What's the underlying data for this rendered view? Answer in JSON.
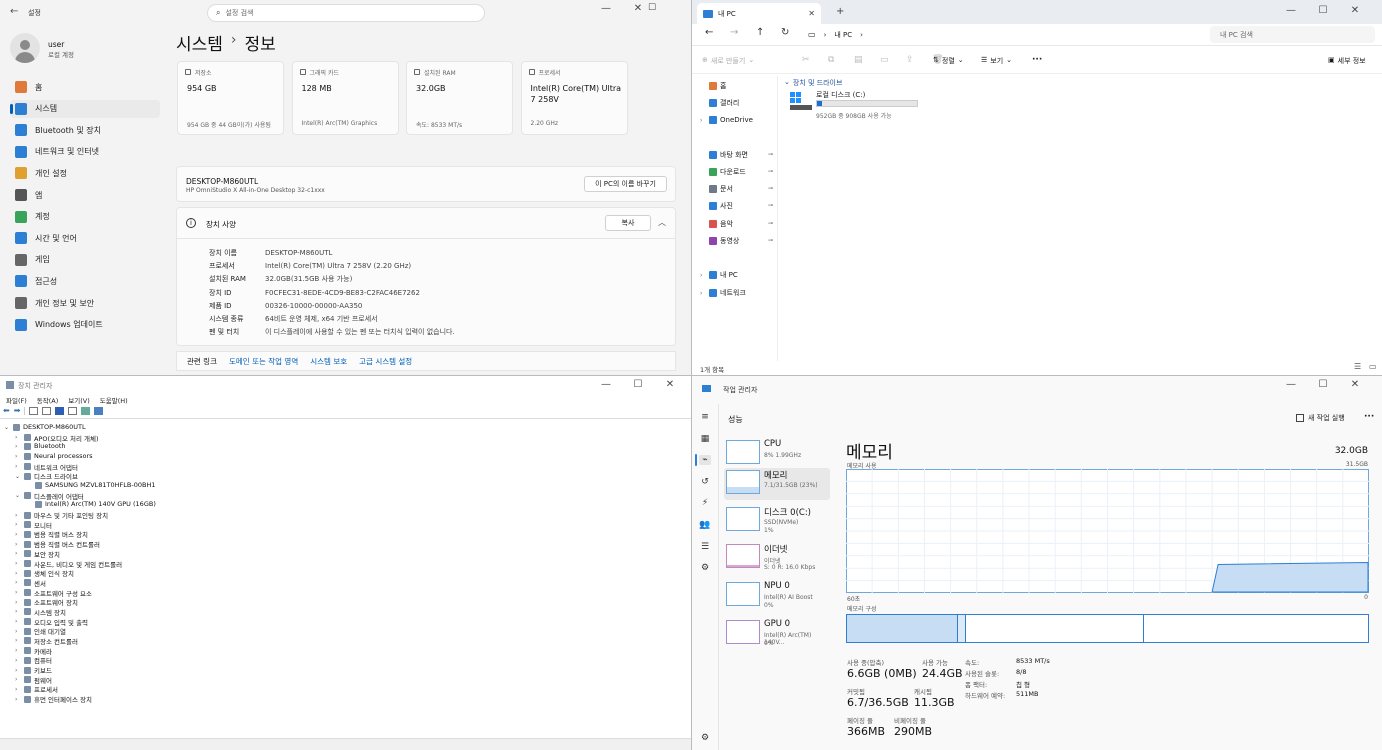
{
  "settings": {
    "app_title": "설정",
    "search_placeholder": "설정 검색",
    "user_name": "user",
    "user_sub": "로컬 계정",
    "breadcrumb_parent": "시스템",
    "breadcrumb_sep": "›",
    "breadcrumb_current": "정보",
    "nav": [
      {
        "label": "홈",
        "color": "#e07a3a"
      },
      {
        "label": "시스템",
        "color": "#2d7fd3"
      },
      {
        "label": "Bluetooth 및 장치",
        "color": "#2d7fd3"
      },
      {
        "label": "네트워크 및 인터넷",
        "color": "#2d7fd3"
      },
      {
        "label": "개인 설정",
        "color": "#e0a030"
      },
      {
        "label": "앱",
        "color": "#555"
      },
      {
        "label": "계정",
        "color": "#3aa35a"
      },
      {
        "label": "시간 및 언어",
        "color": "#2d7fd3"
      },
      {
        "label": "게임",
        "color": "#666"
      },
      {
        "label": "접근성",
        "color": "#2d7fd3"
      },
      {
        "label": "개인 정보 및 보안",
        "color": "#666"
      },
      {
        "label": "Windows 업데이트",
        "color": "#2d7fd3"
      }
    ],
    "cards": [
      {
        "label": "저장소",
        "value": "954 GB",
        "sub": "954 GB 중 44 GB이(가) 사용됨"
      },
      {
        "label": "그래픽 카드",
        "value": "128 MB",
        "sub": "Intel(R) Arc(TM) Graphics"
      },
      {
        "label": "설치된 RAM",
        "value": "32.0GB",
        "sub": "속도: 8533 MT/s"
      },
      {
        "label": "프로세서",
        "value": "Intel(R) Core(TM) Ultra 7 258V",
        "sub": "2.20 GHz"
      }
    ],
    "device_name": "DESKTOP-M860UTL",
    "device_model": "HP OmniStudio X All-in-One Desktop 32-c1xxx",
    "rename_button": "이 PC의 이름 바꾸기",
    "spec_title": "장치 사양",
    "copy_button": "복사",
    "specs": [
      {
        "k": "장치 이름",
        "v": "DESKTOP-M860UTL"
      },
      {
        "k": "프로세서",
        "v": "Intel(R) Core(TM) Ultra 7 258V (2.20 GHz)"
      },
      {
        "k": "설치된 RAM",
        "v": "32.0GB(31.5GB 사용 가능)"
      },
      {
        "k": "장치 ID",
        "v": "F0CFEC31-8EDE-4CD9-BE83-C2FAC46E7262"
      },
      {
        "k": "제품 ID",
        "v": "00326-10000-00000-AA350"
      },
      {
        "k": "시스템 종류",
        "v": "64비트 운영 체제, x64 기반 프로세서"
      },
      {
        "k": "펜 및 터치",
        "v": "이 디스플레이에 사용할 수 있는 펜 또는 터치식 입력이 없습니다."
      }
    ],
    "related_label": "관련 링크",
    "related_links": [
      "도메인 또는 작업 영역",
      "시스템 보호",
      "고급 시스템 설정"
    ]
  },
  "explorer": {
    "tab_title": "내 PC",
    "tab_close": "✕",
    "tab_add": "+",
    "address": "내 PC",
    "search_placeholder": "내 PC 검색",
    "new_button": "새로 만들기",
    "sort_button": "정렬",
    "view_button": "보기",
    "more_button": "···",
    "details_button": "세부 정보",
    "nav_items": [
      {
        "label": "홈",
        "color": "#e07a3a",
        "pin": false
      },
      {
        "label": "갤러리",
        "color": "#2d7fd3",
        "pin": false
      },
      {
        "label": "OneDrive",
        "color": "#2d7fd3",
        "pin": false
      },
      {
        "label": "바탕 화면",
        "color": "#2d7fd3",
        "pin": true
      },
      {
        "label": "다운로드",
        "color": "#3aa35a",
        "pin": true
      },
      {
        "label": "문서",
        "color": "#6c7a89",
        "pin": true
      },
      {
        "label": "사진",
        "color": "#2d7fd3",
        "pin": true
      },
      {
        "label": "음악",
        "color": "#d9534f",
        "pin": true
      },
      {
        "label": "동영상",
        "color": "#8e44ad",
        "pin": true
      },
      {
        "label": "내 PC",
        "color": "#2d7fd3",
        "pin": false
      },
      {
        "label": "네트워크",
        "color": "#2d7fd3",
        "pin": false
      }
    ],
    "group_header": "장치 및 드라이브",
    "drive_name": "로컬 디스크 (C:)",
    "drive_sub": "952GB 중 908GB 사용 가능",
    "drive_used_fraction": 0.046,
    "status": "1개 항목"
  },
  "devmgr": {
    "title": "장치 관리자",
    "menu": [
      "파일(F)",
      "동작(A)",
      "보기(V)",
      "도움말(H)"
    ],
    "items": [
      {
        "label": "DESKTOP-M860UTL",
        "level": 0,
        "tw": "⌄"
      },
      {
        "label": "APO(오디오 처리 개체)",
        "level": 1,
        "tw": "›"
      },
      {
        "label": "Bluetooth",
        "level": 1,
        "tw": "›"
      },
      {
        "label": "Neural processors",
        "level": 1,
        "tw": "›"
      },
      {
        "label": "네트워크 어댑터",
        "level": 1,
        "tw": "›"
      },
      {
        "label": "디스크 드라이브",
        "level": 1,
        "tw": "⌄"
      },
      {
        "label": "SAMSUNG MZVL81T0HFLB-00BH1",
        "level": 2,
        "tw": ""
      },
      {
        "label": "디스플레이 어댑터",
        "level": 1,
        "tw": "⌄"
      },
      {
        "label": "Intel(R) Arc(TM) 140V GPU (16GB)",
        "level": 2,
        "tw": ""
      },
      {
        "label": "마우스 및 기타 포인팅 장치",
        "level": 1,
        "tw": "›"
      },
      {
        "label": "모니터",
        "level": 1,
        "tw": "›"
      },
      {
        "label": "범용 직렬 버스 장치",
        "level": 1,
        "tw": "›"
      },
      {
        "label": "범용 직렬 버스 컨트롤러",
        "level": 1,
        "tw": "›"
      },
      {
        "label": "보안 장치",
        "level": 1,
        "tw": "›"
      },
      {
        "label": "사운드, 비디오 및 게임 컨트롤러",
        "level": 1,
        "tw": "›"
      },
      {
        "label": "생체 인식 장치",
        "level": 1,
        "tw": "›"
      },
      {
        "label": "센서",
        "level": 1,
        "tw": "›"
      },
      {
        "label": "소프트웨어 구성 요소",
        "level": 1,
        "tw": "›"
      },
      {
        "label": "소프트웨어 장치",
        "level": 1,
        "tw": "›"
      },
      {
        "label": "시스템 장치",
        "level": 1,
        "tw": "›"
      },
      {
        "label": "오디오 입력 및 출력",
        "level": 1,
        "tw": "›"
      },
      {
        "label": "인쇄 대기열",
        "level": 1,
        "tw": "›"
      },
      {
        "label": "저장소 컨트롤러",
        "level": 1,
        "tw": "›"
      },
      {
        "label": "카메라",
        "level": 1,
        "tw": "›"
      },
      {
        "label": "컴퓨터",
        "level": 1,
        "tw": "›"
      },
      {
        "label": "키보드",
        "level": 1,
        "tw": "›"
      },
      {
        "label": "펌웨어",
        "level": 1,
        "tw": "›"
      },
      {
        "label": "프로세서",
        "level": 1,
        "tw": "›"
      },
      {
        "label": "휴먼 인터페이스 장치",
        "level": 1,
        "tw": "›"
      }
    ]
  },
  "taskmgr": {
    "title": "작업 관리자",
    "section": "성능",
    "new_task_button": "새 작업 실행",
    "more_button": "···",
    "perf_items": [
      {
        "name": "CPU",
        "sub1": "8%  1.99GHz",
        "sub2": ""
      },
      {
        "name": "메모리",
        "sub1": "7.1/31.5GB (23%)",
        "sub2": ""
      },
      {
        "name": "디스크 0(C:)",
        "sub1": "SSD(NVMe)",
        "sub2": "1%"
      },
      {
        "name": "이더넷",
        "sub1": "이더넷",
        "sub2": "S: 0 R: 16.0 Kbps"
      },
      {
        "name": "NPU 0",
        "sub1": "Intel(R) AI Boost",
        "sub2": "0%"
      },
      {
        "name": "GPU 0",
        "sub1": "Intel(R) Arc(TM) 140V...",
        "sub2": "0%"
      }
    ],
    "heading": "메모리",
    "total": "32.0GB",
    "usage_label": "메모리 사용",
    "usage_max": "31.5GB",
    "axis_left": "60초",
    "axis_right": "0",
    "usage_fraction": 0.23,
    "composition_label": "메모리 구성",
    "stats": {
      "in_use_label": "사용 중(압축)",
      "in_use": "6.6GB (0MB)",
      "available_label": "사용 가능",
      "available": "24.4GB",
      "committed_label": "커밋됨",
      "committed": "6.7/36.5GB",
      "cached_label": "캐시됨",
      "cached": "11.3GB",
      "paged_label": "페이징 풀",
      "paged": "366MB",
      "nonpaged_label": "비페이징 풀",
      "nonpaged": "290MB",
      "speed_label": "속도:",
      "speed": "8533 MT/s",
      "slots_label": "사용된 슬롯:",
      "slots": "8/8",
      "form_label": "폼 팩터:",
      "form": "칩 형",
      "reserved_label": "하드웨어 예약:",
      "reserved": "511MB"
    }
  }
}
